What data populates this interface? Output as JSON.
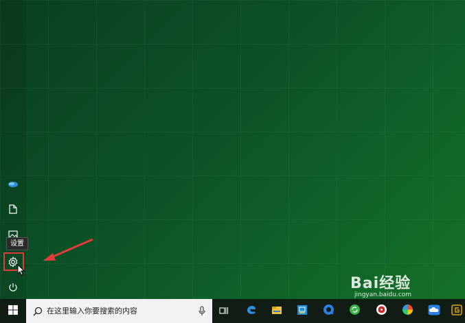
{
  "start_menu": {
    "items": [
      {
        "name": "user-avatar-icon"
      },
      {
        "name": "documents-icon"
      },
      {
        "name": "pictures-icon"
      },
      {
        "name": "settings-icon",
        "tooltip": "设置"
      },
      {
        "name": "power-icon"
      }
    ]
  },
  "annotation": {
    "highlight_color": "#e23b3b"
  },
  "taskbar": {
    "search_placeholder": "在这里输入你要搜索的内容",
    "pinned_icons": [
      "task-view-icon",
      "edge-icon",
      "file-explorer-icon",
      "store-icon",
      "browser-icon",
      "refresh-app-icon",
      "record-app-icon",
      "color-wheel-icon",
      "cloud-app-icon",
      "app-icon"
    ]
  },
  "watermark": {
    "brand": "Bai经验",
    "url": "jingyan.baidu.com"
  }
}
